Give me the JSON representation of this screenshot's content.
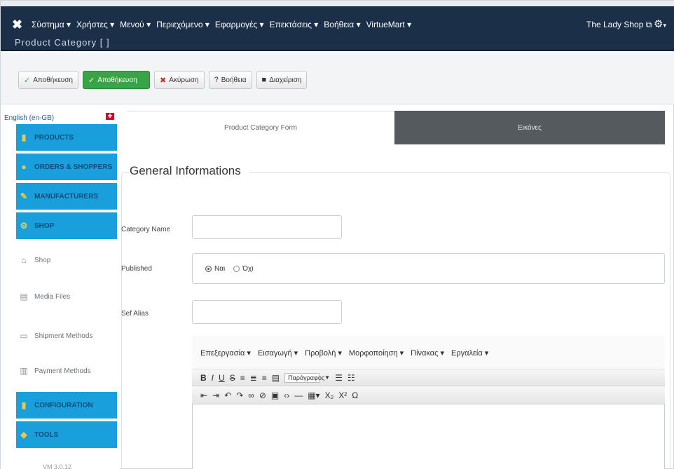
{
  "topbar": {
    "menu": [
      "Σύστημα ▾",
      "Χρήστες ▾",
      "Μενού ▾",
      "Περιεχόμενο ▾",
      "Εφαρμογές ▾",
      "Επεκτάσεις ▾",
      "Βοήθεια ▾",
      "VirtueMart ▾"
    ],
    "subtitle": "Product Category [ ]",
    "site_name": "The Lady Shop ⧉",
    "gear_caret": "▾"
  },
  "toolbar": {
    "buttons": [
      {
        "label": "Αποθήκευση",
        "icon": "✓"
      },
      {
        "label": "Αποθήκευση",
        "icon": "✓"
      },
      {
        "label": "Ακύρωση",
        "icon": "✖"
      },
      {
        "label": "Βοήθεια",
        "icon": "?"
      },
      {
        "label": "Διαχείριση",
        "icon": "■"
      }
    ]
  },
  "sidebar": {
    "language": "English (en-GB)",
    "items": [
      {
        "label": "PRODUCTS"
      },
      {
        "label": "ORDERS & SHOPPERS"
      },
      {
        "label": "MANUFACTURERS"
      },
      {
        "label": "SHOP"
      },
      {
        "label": "Shop"
      },
      {
        "label": "Media Files"
      },
      {
        "label": "Shipment Methods"
      },
      {
        "label": "Payment Methods"
      },
      {
        "label": "CONFIGURATION"
      },
      {
        "label": "TOOLS"
      }
    ],
    "footer": "VM 3.0.12"
  },
  "tabs": {
    "form": "Product Category Form",
    "images": "Εικόνες"
  },
  "form": {
    "legend": "General Informations",
    "category_name_label": "Category Name",
    "category_name_value": "",
    "published_label": "Published",
    "published_yes": "Ναι",
    "published_no": "Όχι",
    "sef_alias_label": "Sef Alias",
    "sef_alias_value": ""
  },
  "editor": {
    "menu": [
      "Επεξεργασία ▾",
      "Εισαγωγή ▾",
      "Προβολή ▾",
      "Μορφοποίηση ▾",
      "Πίνακας ▾",
      "Εργαλεία ▾"
    ],
    "paragraph_select": "Παράγραφος"
  },
  "colors": {
    "topbar": "#1b2f48",
    "green": "#3aa346",
    "sidebar_blue": "#19a0dc",
    "tab_inactive": "#555a5f"
  }
}
